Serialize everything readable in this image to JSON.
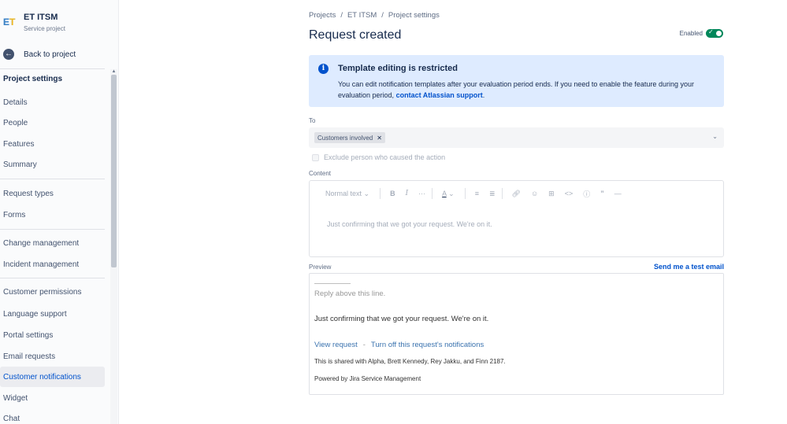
{
  "sidebar": {
    "project_name": "ET ITSM",
    "project_type": "Service project",
    "back_label": "Back to project",
    "heading": "Project settings",
    "items": [
      {
        "label": "Details"
      },
      {
        "label": "People"
      },
      {
        "label": "Features"
      },
      {
        "label": "Summary"
      },
      {
        "label": "Request types"
      },
      {
        "label": "Forms"
      },
      {
        "label": "Change management"
      },
      {
        "label": "Incident management"
      },
      {
        "label": "Customer permissions"
      },
      {
        "label": "Language support"
      },
      {
        "label": "Portal settings"
      },
      {
        "label": "Email requests"
      },
      {
        "label": "Customer notifications",
        "active": true
      },
      {
        "label": "Widget"
      },
      {
        "label": "Chat"
      }
    ]
  },
  "breadcrumbs": [
    "Projects",
    "ET ITSM",
    "Project settings"
  ],
  "page": {
    "title": "Request created",
    "enabled_label": "Enabled",
    "enabled": true
  },
  "banner": {
    "title": "Template editing is restricted",
    "text": "You can edit notification templates after your evaluation period ends. If you need to enable the feature during your evaluation period,",
    "link": "contact Atlassian support",
    "suffix": "."
  },
  "to": {
    "label": "To",
    "chip": "Customers involved"
  },
  "exclude": {
    "label": "Exclude person who caused the action",
    "checked": false
  },
  "content": {
    "label": "Content",
    "text_style": "Normal text",
    "body": "Just confirming that we got your request. We're on it."
  },
  "preview": {
    "label": "Preview",
    "test_email": "Send me a test email",
    "reply_line": "Reply above this line.",
    "body": "Just confirming that we got your request. We're on it.",
    "view_request": "View request",
    "dash": "-",
    "turn_off": "Turn off this request's notifications",
    "shared": "This is shared with Alpha, Brett Kennedy, Rey Jakku, and Finn 2187.",
    "powered": "Powered by Jira Service Management"
  },
  "colors": {
    "accent": "#0052cc",
    "toggle_on": "#00875a",
    "banner_bg": "#deebff"
  }
}
